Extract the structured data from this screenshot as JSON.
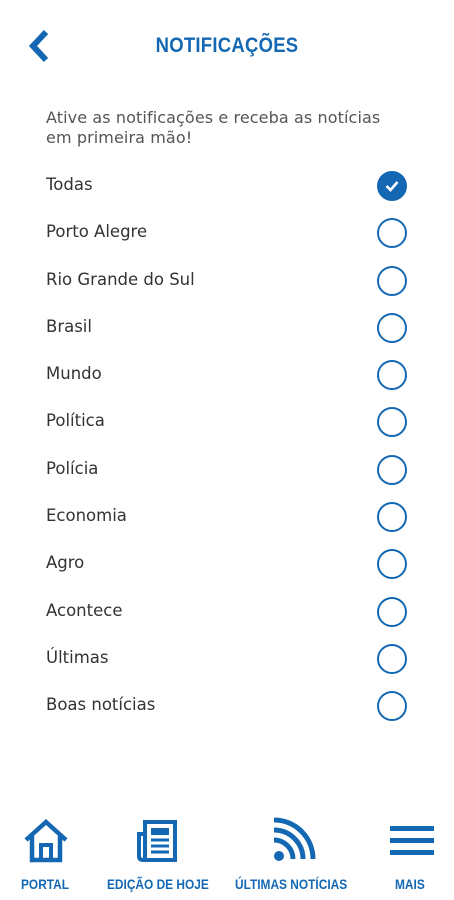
{
  "header": {
    "title": "NOTIFICAÇÕES",
    "back_icon": "chevron-left-icon"
  },
  "intro_text": "Ative as notificações e receba as notícias em primeira mão!",
  "colors": {
    "accent": "#1468b3",
    "text": "#333333",
    "muted": "#555555"
  },
  "topics": [
    {
      "label": "Todas",
      "checked": true
    },
    {
      "label": "Porto Alegre",
      "checked": false
    },
    {
      "label": "Rio Grande do Sul",
      "checked": false
    },
    {
      "label": "Brasil",
      "checked": false
    },
    {
      "label": "Mundo",
      "checked": false
    },
    {
      "label": "Política",
      "checked": false
    },
    {
      "label": "Polícia",
      "checked": false
    },
    {
      "label": "Economia",
      "checked": false
    },
    {
      "label": "Agro",
      "checked": false
    },
    {
      "label": "Acontece",
      "checked": false
    },
    {
      "label": "Últimas",
      "checked": false
    },
    {
      "label": "Boas notícias",
      "checked": false
    }
  ],
  "bottom_nav": [
    {
      "label": "PORTAL",
      "icon": "home-icon"
    },
    {
      "label": "EDIÇÃO DE HOJE",
      "icon": "newspaper-icon"
    },
    {
      "label": "ÚLTIMAS NOTÍCIAS",
      "icon": "rss-icon"
    },
    {
      "label": "MAIS",
      "icon": "menu-icon"
    }
  ]
}
